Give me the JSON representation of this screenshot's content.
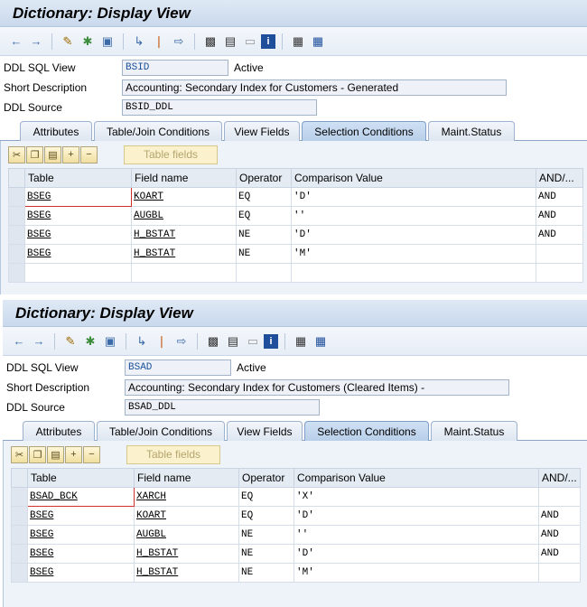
{
  "panels": [
    {
      "title": "Dictionary: Display View",
      "fields": {
        "ddl_sql_view_label": "DDL SQL View",
        "ddl_sql_view_value": "BSID",
        "status": "Active",
        "short_description_label": "Short Description",
        "short_description_value": "Accounting: Secondary Index for Customers - Generated",
        "ddl_source_label": "DDL Source",
        "ddl_source_value": "BSID_DDL"
      },
      "tabs": [
        "Attributes",
        "Table/Join Conditions",
        "View Fields",
        "Selection Conditions",
        "Maint.Status"
      ],
      "active_tab": "Selection Conditions",
      "table_fields_label": "Table fields",
      "columns": [
        "Table",
        "Field name",
        "Operator",
        "Comparison Value",
        "AND/..."
      ],
      "rows": [
        [
          "BSEG",
          "KOART",
          "EQ",
          "'D'",
          "AND"
        ],
        [
          "BSEG",
          "AUGBL",
          "EQ",
          "''",
          "AND"
        ],
        [
          "BSEG",
          "H_BSTAT",
          "NE",
          "'D'",
          "AND"
        ],
        [
          "BSEG",
          "H_BSTAT",
          "NE",
          "'M'",
          ""
        ],
        [
          "",
          "",
          "",
          "",
          ""
        ]
      ]
    },
    {
      "title": "Dictionary: Display View",
      "fields": {
        "ddl_sql_view_label": "DDL SQL View",
        "ddl_sql_view_value": "BSAD",
        "status": "Active",
        "short_description_label": "Short Description",
        "short_description_value": "Accounting: Secondary Index for Customers (Cleared Items) -",
        "ddl_source_label": "DDL Source",
        "ddl_source_value": "BSAD_DDL"
      },
      "tabs": [
        "Attributes",
        "Table/Join Conditions",
        "View Fields",
        "Selection Conditions",
        "Maint.Status"
      ],
      "active_tab": "Selection Conditions",
      "table_fields_label": "Table fields",
      "columns": [
        "Table",
        "Field name",
        "Operator",
        "Comparison Value",
        "AND/..."
      ],
      "rows": [
        [
          "BSAD_BCK",
          "XARCH",
          "EQ",
          "'X'",
          ""
        ],
        [
          "BSEG",
          "KOART",
          "EQ",
          "'D'",
          "AND"
        ],
        [
          "BSEG",
          "AUGBL",
          "NE",
          "''",
          "AND"
        ],
        [
          "BSEG",
          "H_BSTAT",
          "NE",
          "'D'",
          "AND"
        ],
        [
          "BSEG",
          "H_BSTAT",
          "NE",
          "'M'",
          ""
        ]
      ]
    }
  ],
  "toolbar_icons": [
    "back-arrow-icon",
    "forward-arrow-icon",
    "display-change-icon",
    "other-object-icon",
    "activate-icon",
    "where-used-icon",
    "object-list-icon",
    "navigation-window-icon",
    "hierarchy-icon",
    "print-icon",
    "window-icon",
    "info-icon",
    "data-browser-icon",
    "table-icon"
  ],
  "content_toolbar_icons": [
    "cut-icon",
    "copy-icon",
    "paste-icon",
    "insert-row-icon",
    "delete-row-icon"
  ]
}
